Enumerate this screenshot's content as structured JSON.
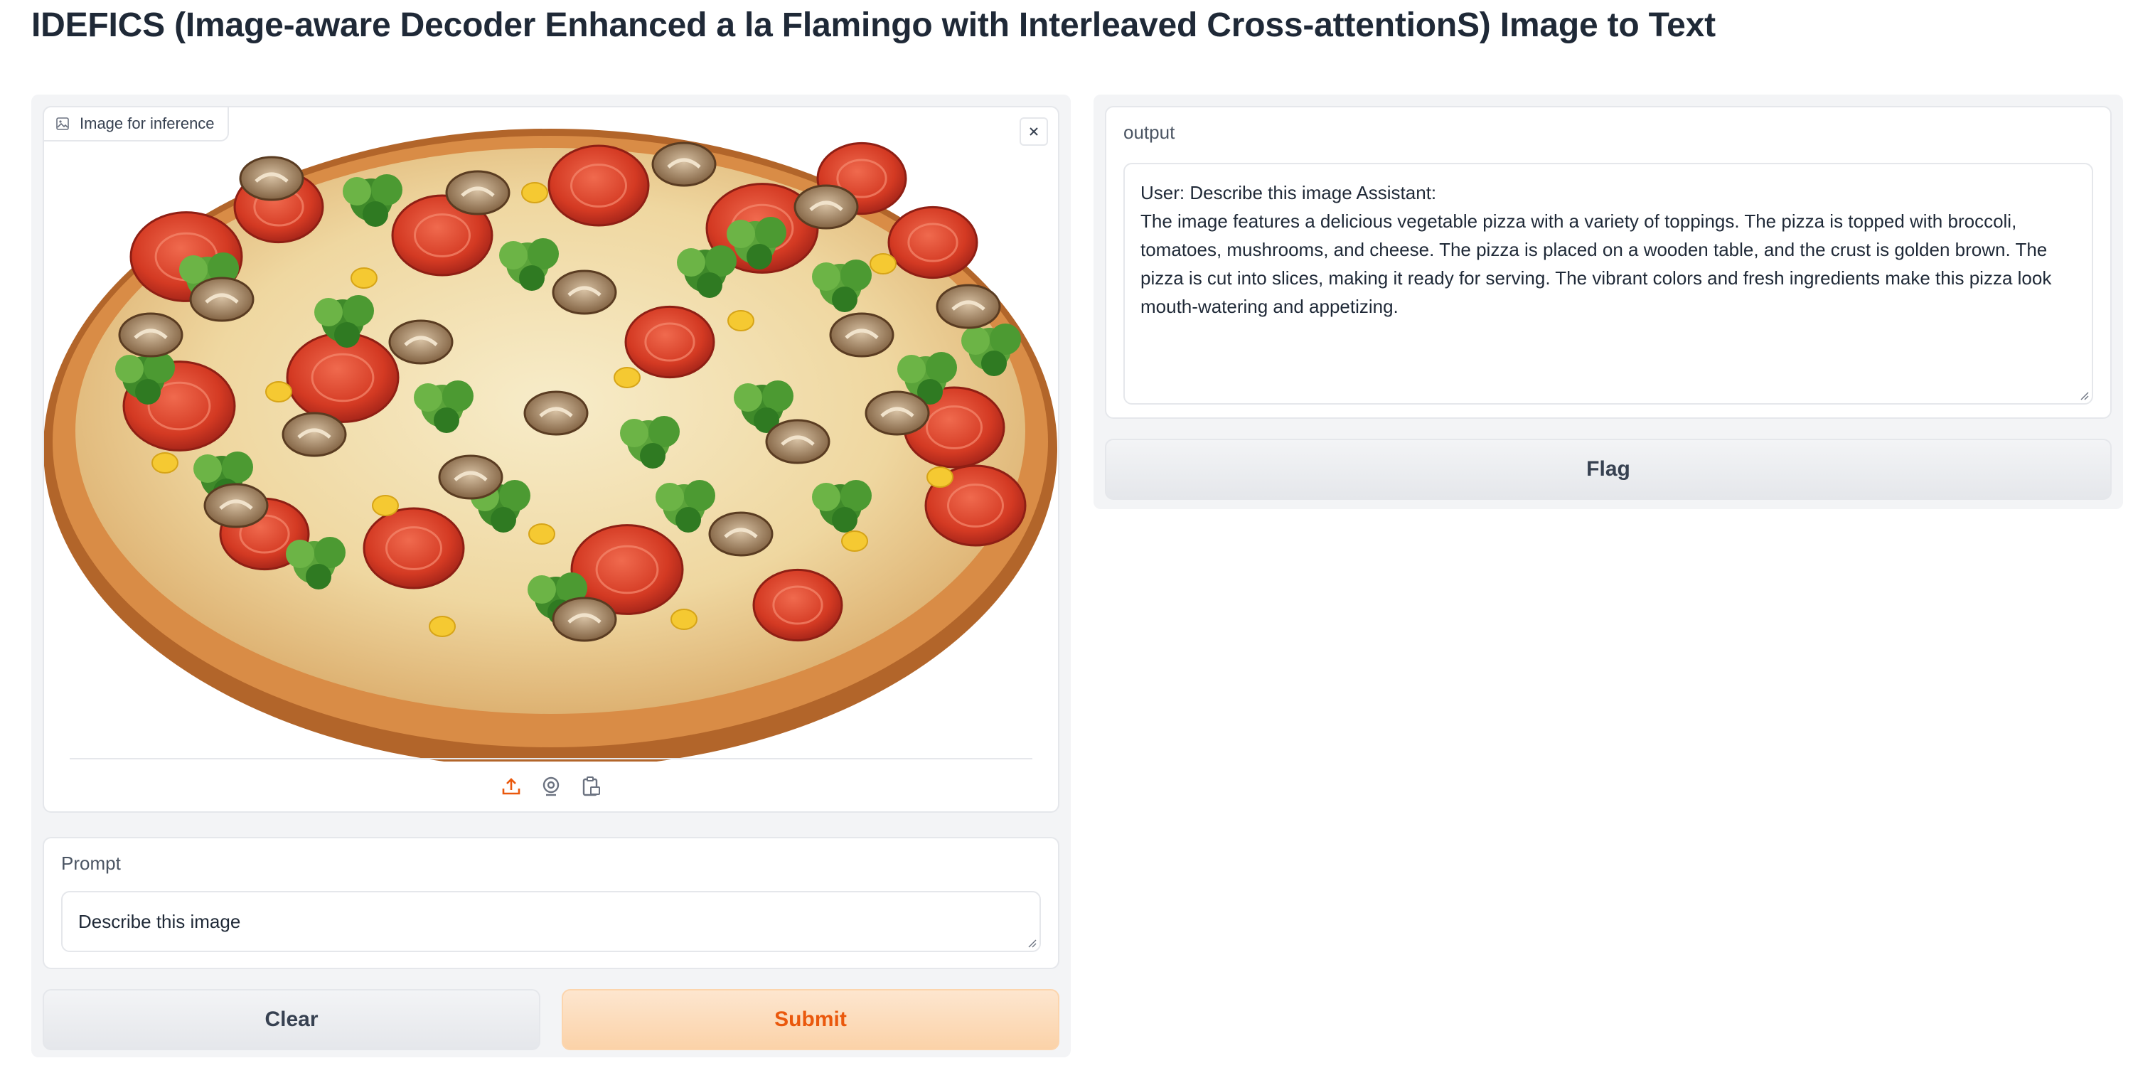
{
  "title": "IDEFICS (Image-aware Decoder Enhanced a la Flamingo with Interleaved Cross-attentionS) Image to Text",
  "image_input": {
    "label": "Image for inference",
    "label_icon": "image-icon",
    "close_icon": "close-icon",
    "sources": [
      "upload-icon",
      "webcam-icon",
      "clipboard-icon"
    ]
  },
  "prompt": {
    "label": "Prompt",
    "value": "Describe this image"
  },
  "buttons": {
    "clear": "Clear",
    "submit": "Submit",
    "flag": "Flag"
  },
  "output": {
    "label": "output",
    "lines": [
      "User: Describe this image Assistant:",
      "The image features a delicious vegetable pizza with a variety of toppings. The pizza is topped with broccoli,",
      "tomatoes, mushrooms, and cheese. The pizza is placed on a wooden table, and the crust is golden brown. The",
      "pizza is cut into slices, making it ready for serving. The vibrant colors and fresh ingredients make this pizza look",
      "mouth-watering and appetizing."
    ]
  },
  "colors": {
    "accent": "#ea580c",
    "submit_bg": "#fbd2a8",
    "panel_bg": "#f3f4f6",
    "border": "#e5e7eb"
  }
}
